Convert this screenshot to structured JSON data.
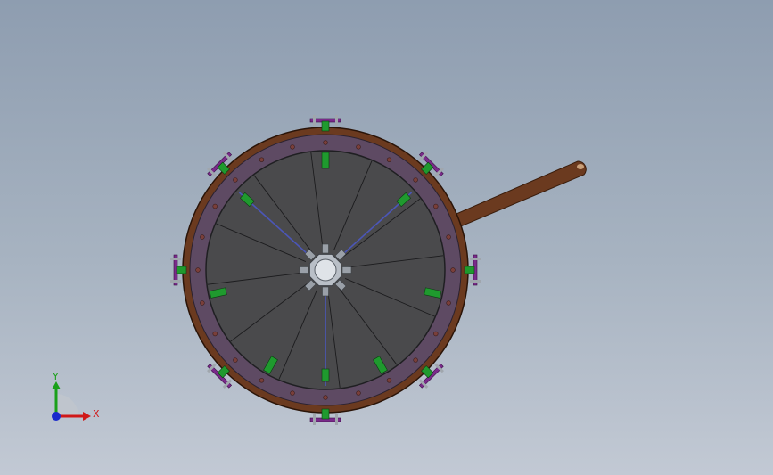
{
  "viewport": {
    "background_top": "#8e9db0",
    "background_bottom": "#c2c9d4"
  },
  "model": {
    "outer_rim_color": "#6b3a1f",
    "flange_color": "#5e4a63",
    "face_color": "#4a4a4c",
    "hub_color": "#b9bfc7",
    "handle_color": "#6b3a1f",
    "tab_color": "#1f9a2e",
    "clamp_color": "#7a2a8a",
    "spoke_color": "#4b56b8",
    "radial_segments": 12,
    "clamp_count": 8,
    "bolt_hole_count": 24
  },
  "triad": {
    "x_label": "X",
    "y_label": "Y",
    "x_color": "#d01818",
    "y_color": "#1aa01a",
    "z_color": "#1a2acc"
  }
}
